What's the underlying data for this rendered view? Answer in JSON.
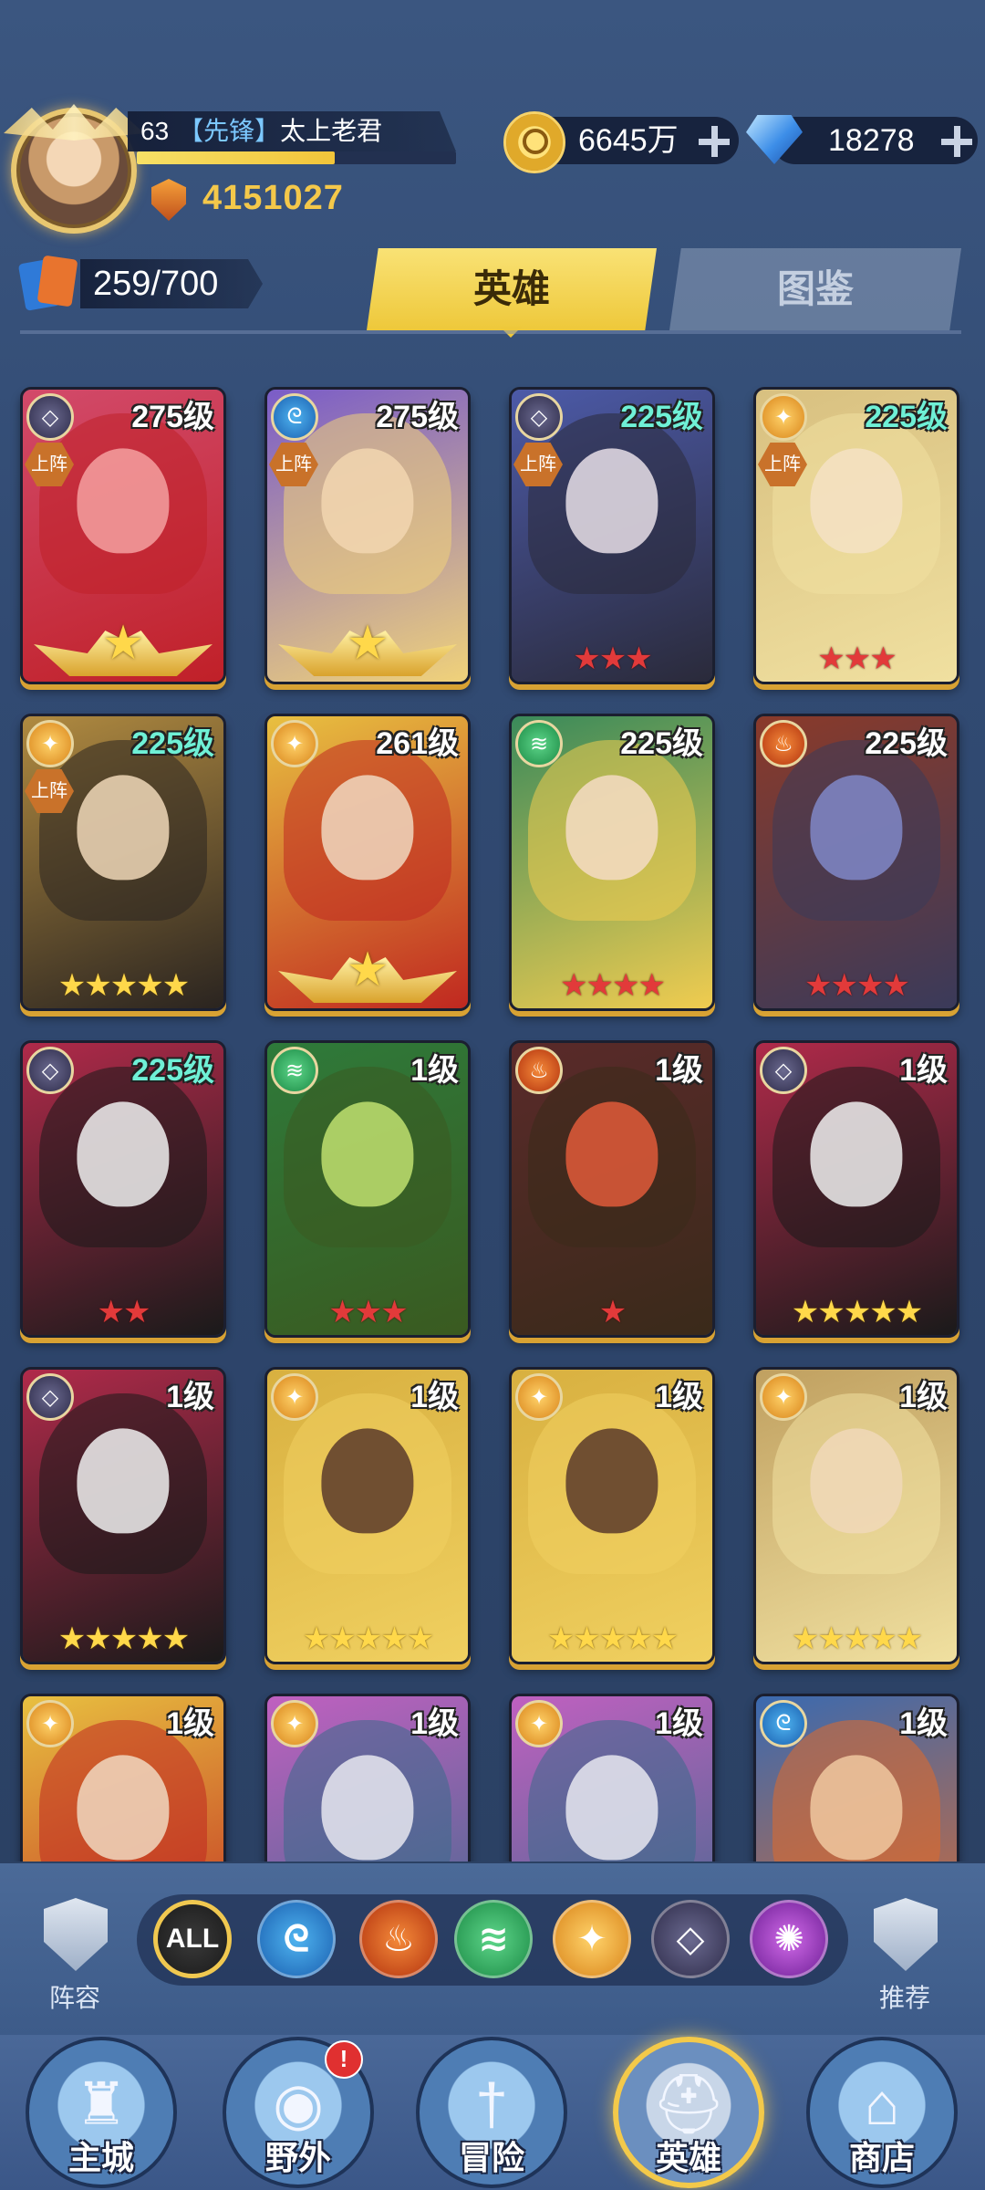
{
  "player": {
    "level": "63",
    "rank": "【先锋】",
    "name": "太上老君",
    "power": "4151027",
    "xp_fraction": 0.62
  },
  "currency": {
    "gold": "6645万",
    "gems": "18278"
  },
  "heroes_count": "259/700",
  "tabs": {
    "heroes": "英雄",
    "gallery": "图鉴"
  },
  "heroes": [
    {
      "level": "275级",
      "faction": "void",
      "deployed": "上阵",
      "stars": "wing",
      "star_color": "gold"
    },
    {
      "level": "275级",
      "faction": "water",
      "deployed": "上阵",
      "stars": "wing",
      "star_color": "gold"
    },
    {
      "level": "225级",
      "faction": "void",
      "deployed": "上阵",
      "stars": "★★★",
      "star_color": "red"
    },
    {
      "level": "225级",
      "faction": "light",
      "deployed": "上阵",
      "stars": "★★★",
      "star_color": "red"
    },
    {
      "level": "225级",
      "faction": "light",
      "deployed": "上阵",
      "stars": "★★★★★",
      "star_color": "gold"
    },
    {
      "level": "261级",
      "faction": "light",
      "deployed": "",
      "stars": "wing",
      "star_color": "gold"
    },
    {
      "level": "225级",
      "faction": "forest",
      "deployed": "",
      "stars": "★★★★",
      "star_color": "red"
    },
    {
      "level": "225级",
      "faction": "fire",
      "deployed": "",
      "stars": "★★★★",
      "star_color": "red"
    },
    {
      "level": "225级",
      "faction": "void",
      "deployed": "",
      "stars": "★★",
      "star_color": "red"
    },
    {
      "level": "1级",
      "faction": "forest",
      "deployed": "",
      "stars": "★★★",
      "star_color": "red"
    },
    {
      "level": "1级",
      "faction": "fire",
      "deployed": "",
      "stars": "★",
      "star_color": "red"
    },
    {
      "level": "1级",
      "faction": "void",
      "deployed": "",
      "stars": "★★★★★",
      "star_color": "gold"
    },
    {
      "level": "1级",
      "faction": "void",
      "deployed": "",
      "stars": "★★★★★",
      "star_color": "gold"
    },
    {
      "level": "1级",
      "faction": "light",
      "deployed": "",
      "stars": "★★★★★",
      "star_color": "gold"
    },
    {
      "level": "1级",
      "faction": "light",
      "deployed": "",
      "stars": "★★★★★",
      "star_color": "gold"
    },
    {
      "level": "1级",
      "faction": "light",
      "deployed": "",
      "stars": "★★★★★",
      "star_color": "gold"
    },
    {
      "level": "1级",
      "faction": "light",
      "deployed": "",
      "stars": "",
      "star_color": "gold"
    },
    {
      "level": "1级",
      "faction": "light",
      "deployed": "",
      "stars": "",
      "star_color": "gold"
    },
    {
      "level": "1级",
      "faction": "light",
      "deployed": "",
      "stars": "",
      "star_color": "gold"
    },
    {
      "level": "1级",
      "faction": "water",
      "deployed": "",
      "stars": "",
      "star_color": "gold"
    }
  ],
  "filters": {
    "left_label": "阵容",
    "all_label": "ALL",
    "right_label": "推荐"
  },
  "nav": {
    "castle": "主城",
    "wild": "野外",
    "adventure": "冒险",
    "heroes": "英雄",
    "shop": "商店",
    "wild_badge": "!"
  }
}
